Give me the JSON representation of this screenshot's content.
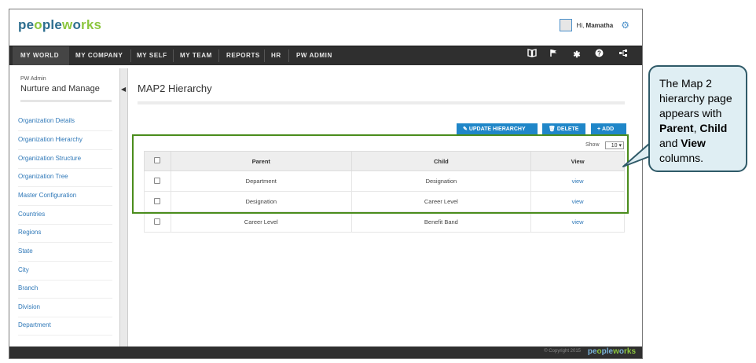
{
  "app": {
    "logo_part1": "pe",
    "logo_part2": "o",
    "logo_part3": "ple",
    "logo_part4": "w",
    "logo_part5": "o",
    "logo_part6": "rks",
    "greeting": "Hi, ",
    "user_name": "Mamatha"
  },
  "nav": {
    "items": [
      "MY WORLD",
      "MY COMPANY",
      "MY SELF",
      "MY TEAM",
      "REPORTS",
      "HR",
      "PW ADMIN"
    ],
    "active": "MY WORLD",
    "icons": [
      "book-icon",
      "flag-icon",
      "tools-icon",
      "help-icon",
      "hierarchy-icon"
    ]
  },
  "sidebar": {
    "subtitle": "PW Admin",
    "title": "Nurture and Manage",
    "items": [
      "Organization Details",
      "Organization Hierarchy",
      "Organization Structure",
      "Organization Tree",
      "Master Configuration",
      "Countries",
      "Regions",
      "State",
      "City",
      "Branch",
      "Division",
      "Department"
    ]
  },
  "main": {
    "title": "MAP2 Hierarchy",
    "buttons": {
      "update": "UPDATE HIERARCHY",
      "delete": "DELETE",
      "add": "ADD"
    },
    "show_label": "Show",
    "show_value": "10",
    "table": {
      "headers": [
        "Parent",
        "Child",
        "View"
      ],
      "rows": [
        {
          "parent": "Department",
          "child": "Designation",
          "view": "view"
        },
        {
          "parent": "Designation",
          "child": "Career Level",
          "view": "view"
        },
        {
          "parent": "Career Level",
          "child": "Benefit Band",
          "view": "view"
        }
      ]
    }
  },
  "footer": {
    "copyright": "© Copyright 2015"
  },
  "callout": {
    "line1": "The Map 2 hierarchy page appears with ",
    "b1": "Parent",
    "sep": ", ",
    "b2": "Child",
    "and": " and ",
    "b3": "View",
    "end": " columns."
  },
  "colors": {
    "brand_blue": "#2d6e8f",
    "brand_green": "#8cc63f",
    "button_blue": "#1f86c8",
    "nav_dark": "#2f2f2f",
    "highlight_green": "#4a8c1c"
  }
}
